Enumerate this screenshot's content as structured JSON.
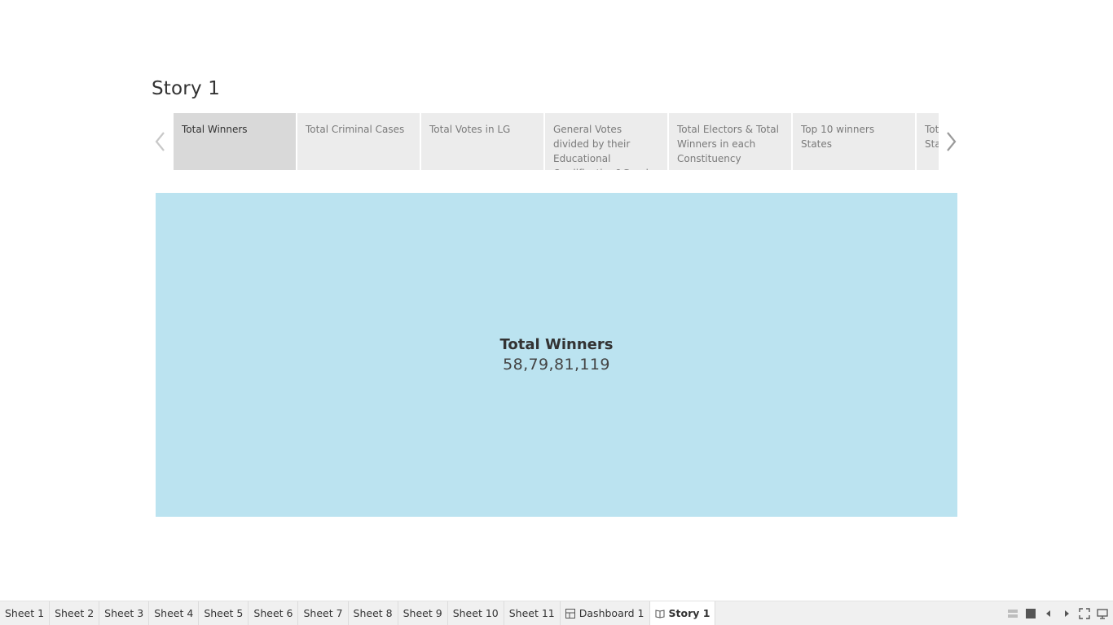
{
  "story": {
    "title": "Story 1"
  },
  "navigator": {
    "prev_icon": "chevron-left-icon",
    "next_icon": "chevron-right-icon",
    "captions": [
      {
        "label": "Total Winners",
        "active": true
      },
      {
        "label": "Total Criminal Cases",
        "active": false
      },
      {
        "label": "Total Votes in LG",
        "active": false
      },
      {
        "label": "General Votes divided by their Educational Qualification&Gender",
        "active": false
      },
      {
        "label": " Total Electors & Total Winners in each Constituency",
        "active": false
      },
      {
        "label": "Top 10 winners States",
        "active": false
      },
      {
        "label": "Total General Votes States",
        "active": false
      }
    ]
  },
  "story_point": {
    "kpi_label": "Total Winners",
    "kpi_value": "58,79,81,119",
    "background_color": "#bbe3f0"
  },
  "tabs": [
    {
      "label": "Sheet 1",
      "icon": null,
      "active": false
    },
    {
      "label": "Sheet 2",
      "icon": null,
      "active": false
    },
    {
      "label": "Sheet 3",
      "icon": null,
      "active": false
    },
    {
      "label": "Sheet 4",
      "icon": null,
      "active": false
    },
    {
      "label": "Sheet 5",
      "icon": null,
      "active": false
    },
    {
      "label": "Sheet 6",
      "icon": null,
      "active": false
    },
    {
      "label": "Sheet 7",
      "icon": null,
      "active": false
    },
    {
      "label": "Sheet 8",
      "icon": null,
      "active": false
    },
    {
      "label": "Sheet 9",
      "icon": null,
      "active": false
    },
    {
      "label": "Sheet 10",
      "icon": null,
      "active": false
    },
    {
      "label": "Sheet 11",
      "icon": null,
      "active": false
    },
    {
      "label": "Dashboard 1",
      "icon": "dashboard-icon",
      "active": false
    },
    {
      "label": "Story 1",
      "icon": "story-icon",
      "active": true
    }
  ],
  "tab_controls": [
    "show-filmstrip-icon",
    "show-tabs-icon",
    "previous-sheet-icon",
    "next-sheet-icon",
    "presentation-mode-icon",
    "device-preview-icon"
  ]
}
